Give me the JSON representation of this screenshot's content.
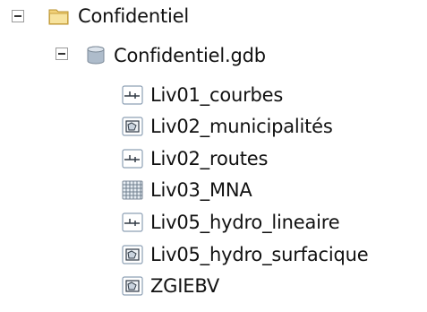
{
  "tree": {
    "folder": {
      "label": "Confidentiel",
      "icon": "folder-icon",
      "expanded": true
    },
    "geodatabase": {
      "label": "Confidentiel.gdb",
      "icon": "geodatabase-icon",
      "expanded": true
    },
    "items": [
      {
        "label": "Liv01_courbes",
        "icon": "line-feature-class-icon"
      },
      {
        "label": "Liv02_municipalités",
        "icon": "polygon-feature-class-icon"
      },
      {
        "label": "Liv02_routes",
        "icon": "line-feature-class-icon"
      },
      {
        "label": "Liv03_MNA",
        "icon": "raster-dataset-icon"
      },
      {
        "label": "Liv05_hydro_lineaire",
        "icon": "line-feature-class-icon"
      },
      {
        "label": "Liv05_hydro_surfacique",
        "icon": "polygon-feature-class-icon"
      },
      {
        "label": "ZGIEBV",
        "icon": "polygon-feature-class-icon"
      }
    ]
  }
}
